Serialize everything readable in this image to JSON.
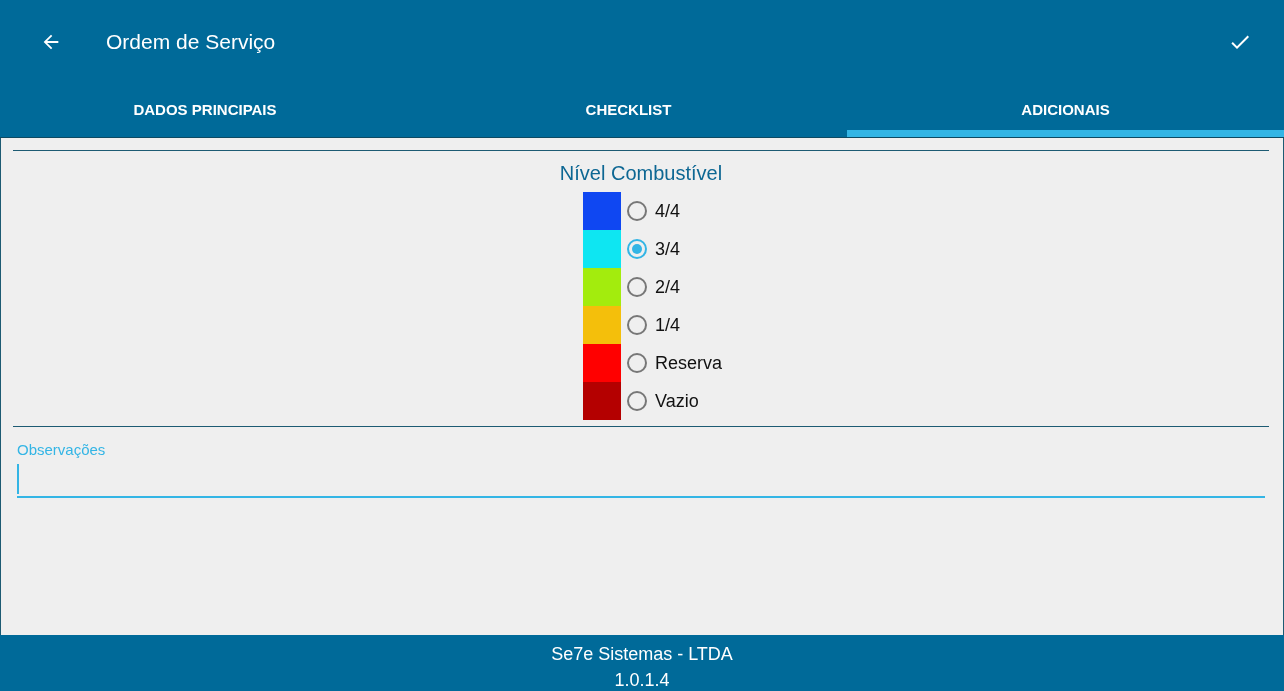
{
  "toolbar": {
    "title": "Ordem de Serviço"
  },
  "tabs": [
    {
      "label": "DADOS PRINCIPAIS",
      "selected": false
    },
    {
      "label": "CHECKLIST",
      "selected": false
    },
    {
      "label": "ADICIONAIS",
      "selected": true
    }
  ],
  "fuel_level": {
    "title": "Nível Combustível",
    "options": [
      {
        "label": "4/4",
        "color": "#0f47f2",
        "selected": false
      },
      {
        "label": "3/4",
        "color": "#0ee6f2",
        "selected": true
      },
      {
        "label": "2/4",
        "color": "#a3ec0d",
        "selected": false
      },
      {
        "label": "1/4",
        "color": "#f4bf0b",
        "selected": false
      },
      {
        "label": "Reserva",
        "color": "#ff0000",
        "selected": false
      },
      {
        "label": "Vazio",
        "color": "#b40000",
        "selected": false
      }
    ]
  },
  "notes_field": {
    "label": "Observações"
  },
  "footer": {
    "company": "Se7e Sistemas - LTDA",
    "version": "1.0.1.4"
  }
}
